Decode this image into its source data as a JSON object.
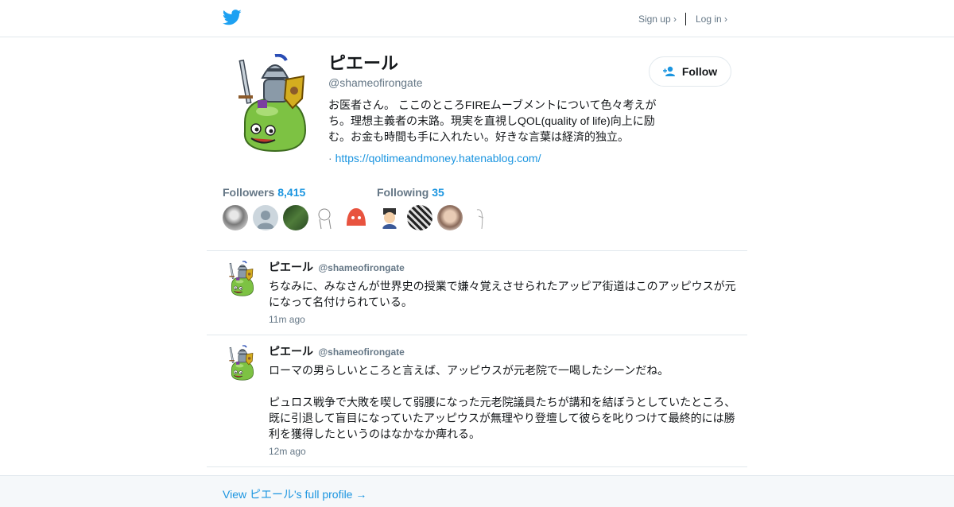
{
  "header": {
    "logo_icon": "twitter-bird-icon",
    "signup_label": "Sign up ›",
    "login_label": "Log in ›"
  },
  "profile": {
    "name": "ピエール",
    "handle": "@shameofirongate",
    "bio": "お医者さん。 ここのところFIREムーブメントについて色々考えがち。理想主義者の末路。現実を直視しQOL(quality of life)向上に励む。お金も時間も手に入れたい。好きな言葉は経済的独立。",
    "link_prefix": "·",
    "link": "https://qoltimeandmoney.hatenablog.com/",
    "follow_label": "Follow",
    "follow_icon": "add-user-icon"
  },
  "followers": {
    "label": "Followers",
    "count": "8,415"
  },
  "following": {
    "label": "Following",
    "count": "35"
  },
  "tweets": [
    {
      "name": "ピエール",
      "handle": "@shameofirongate",
      "text": "ちなみに、みなさんが世界史の授業で嫌々覚えさせられたアッピア街道はこのアッピウスが元になって名付けられている。",
      "time": "11m ago"
    },
    {
      "name": "ピエール",
      "handle": "@shameofirongate",
      "text": "ローマの男らしいところと言えば、アッピウスが元老院で一喝したシーンだね。\n\nピュロス戦争で大敗を喫して弱腰になった元老院議員たちが講和を結ぼうとしていたところ、既に引退して盲目になっていたアッピウスが無理やり登壇して彼らを叱りつけて最終的には勝利を獲得したというのはなかなか痺れる。",
      "time": "12m ago"
    }
  ],
  "footer": {
    "link_label": "View ピエール's full profile →"
  },
  "colors": {
    "accent": "#1b95e0",
    "muted": "#657786",
    "border": "#e1e8ed",
    "twitter_blue": "#1da1f2"
  }
}
